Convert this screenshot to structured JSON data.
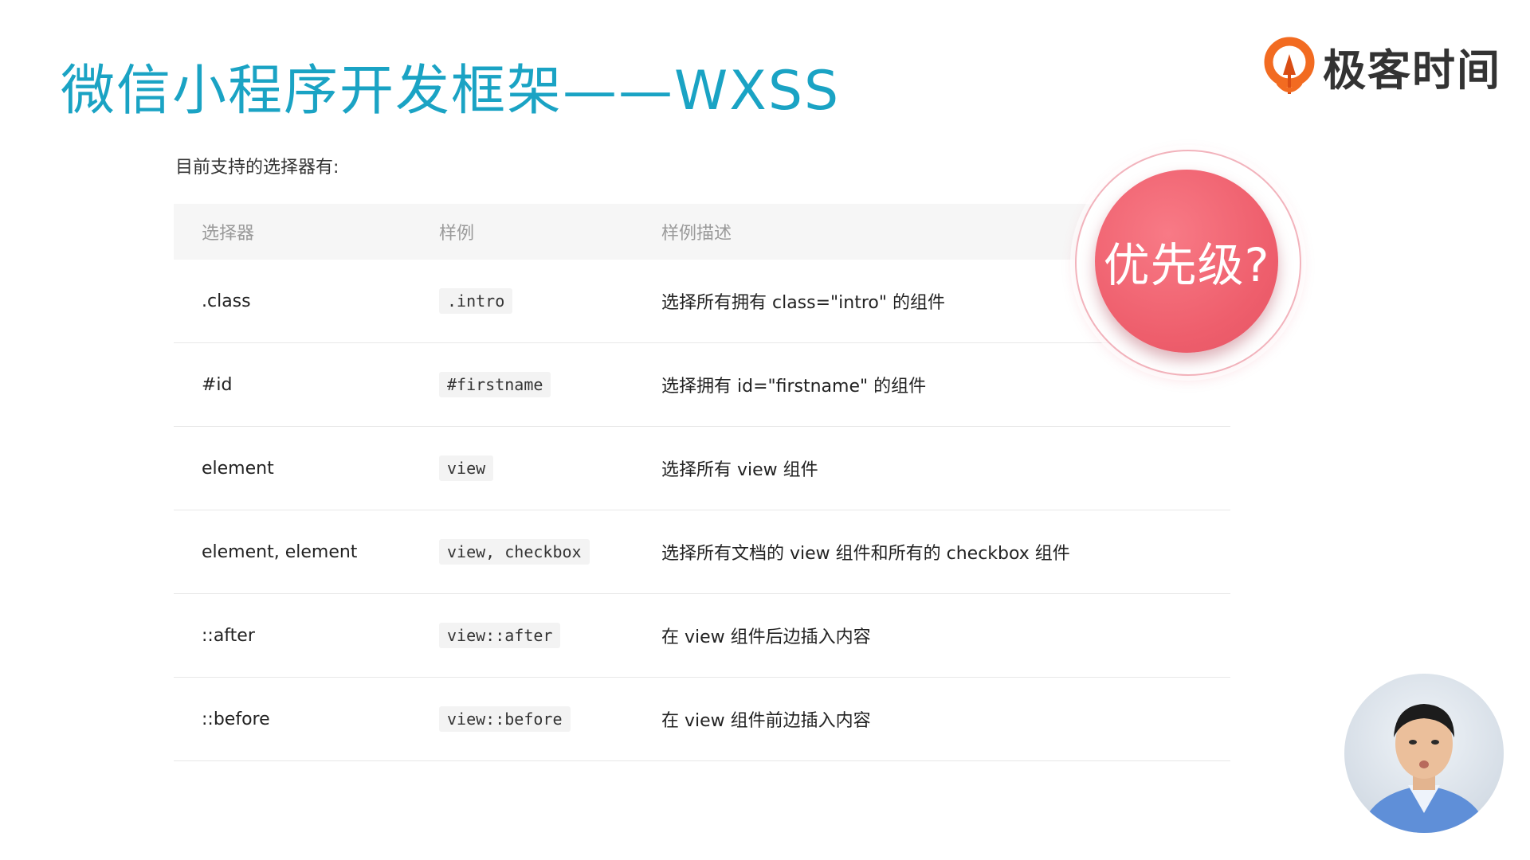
{
  "slide": {
    "title": "微信小程序开发框架——WXSS",
    "intro": "目前支持的选择器有:"
  },
  "brand": {
    "name": "极客时间",
    "logo_icon": "geektime-logo-icon",
    "colors": {
      "logo_orange": "#f26b21",
      "text": "#333333"
    }
  },
  "table": {
    "headers": [
      "选择器",
      "样例",
      "样例描述"
    ],
    "rows": [
      {
        "selector": ".class",
        "example": ".intro",
        "description": "选择所有拥有 class=\"intro\" 的组件"
      },
      {
        "selector": "#id",
        "example": "#firstname",
        "description": "选择拥有 id=\"firstname\" 的组件"
      },
      {
        "selector": "element",
        "example": "view",
        "description": "选择所有 view 组件"
      },
      {
        "selector": "element, element",
        "example": "view, checkbox",
        "description": "选择所有文档的 view 组件和所有的 checkbox 组件"
      },
      {
        "selector": "::after",
        "example": "view::after",
        "description": "在 view 组件后边插入内容"
      },
      {
        "selector": "::before",
        "example": "view::before",
        "description": "在 view 组件前边插入内容"
      }
    ]
  },
  "callout": {
    "text": "优先级?",
    "color": "#ee5e6c"
  },
  "colors": {
    "title": "#1aa3c4",
    "header_bg": "#f6f6f6",
    "code_bg": "#f3f3f3"
  }
}
